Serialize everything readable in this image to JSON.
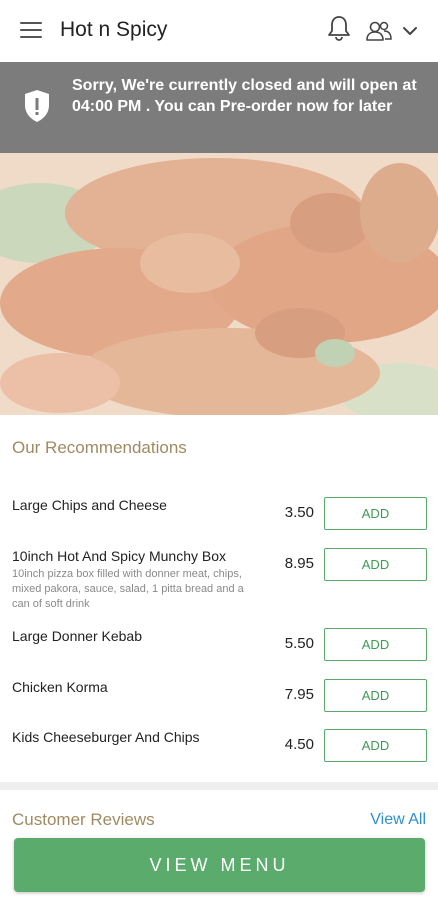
{
  "header": {
    "title": "Hot n Spicy",
    "menu_icon": "hamburger-menu-icon",
    "bell_icon": "bell-icon",
    "user_icon": "users-icon",
    "dropdown_icon": "chevron-down-icon"
  },
  "closed_banner": {
    "message": "Sorry, We're currently closed and will open at 04:00 PM . You can Pre-order now for later",
    "icon": "shield-alert-icon",
    "background": "#7c7c7c"
  },
  "recommendations": {
    "title": "Our Recommendations",
    "items": [
      {
        "name": "Large Chips and Cheese",
        "description": "",
        "price": "3.50",
        "button": "ADD"
      },
      {
        "name": "10inch Hot And Spicy Munchy Box",
        "description": "10inch pizza box filled with donner meat, chips, mixed pakora, sauce, salad, 1 pitta bread and a can of soft drink",
        "price": "8.95",
        "button": "ADD"
      },
      {
        "name": "Large Donner Kebab",
        "description": "",
        "price": "5.50",
        "button": "ADD"
      },
      {
        "name": "Chicken Korma",
        "description": "",
        "price": "7.95",
        "button": "ADD"
      },
      {
        "name": "Kids Cheeseburger And Chips",
        "description": "",
        "price": "4.50",
        "button": "ADD"
      }
    ]
  },
  "reviews": {
    "title": "Customer Reviews",
    "view_all": "View All"
  },
  "footer": {
    "view_menu": "VIEW MENU"
  },
  "colors": {
    "accent_green": "#5aab6c",
    "heading_gold": "#a08a62",
    "link_blue": "#2f8fce"
  }
}
